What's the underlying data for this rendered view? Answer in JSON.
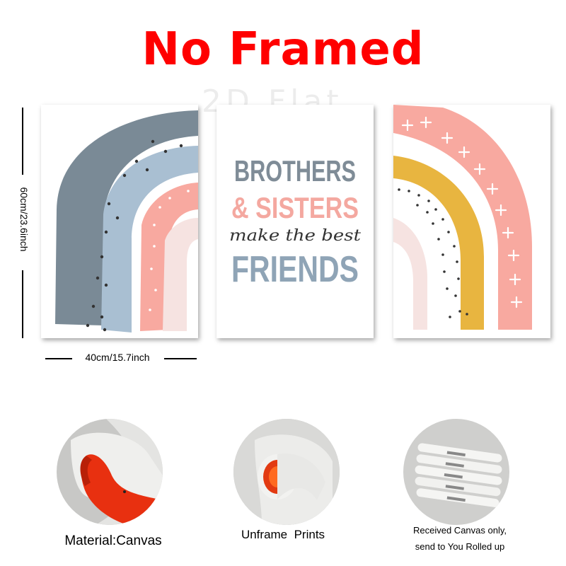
{
  "header": {
    "title": "No Framed",
    "watermark": "2D Flat"
  },
  "dimensions": {
    "height_label": "60cm/23.6inch",
    "width_label": "40cm/15.7inch"
  },
  "posters": {
    "center": {
      "line1": "BROTHERS",
      "line2": "& SISTERS",
      "line3": "make the best",
      "line4": "FRIENDS"
    }
  },
  "features": [
    {
      "label": "Material:Canvas"
    },
    {
      "label": "Unframe  Prints"
    },
    {
      "label_line1": "Received Canvas only,",
      "label_line2": "send to You Rolled up"
    }
  ],
  "colors": {
    "title": "#ff0000",
    "slate": "#7a8a96",
    "light_blue": "#a9bfd2",
    "pink": "#f8a9a0",
    "pale_pink": "#f6e3e1",
    "mustard": "#e8b540"
  }
}
